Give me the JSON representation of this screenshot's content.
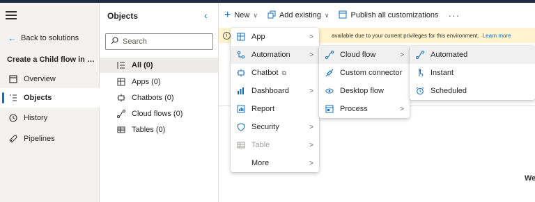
{
  "leftnav": {
    "back_label": "Back to solutions",
    "solution_name": "Create a Child flow in Pa...",
    "items": [
      {
        "label": "Overview",
        "icon": "overview-icon"
      },
      {
        "label": "Objects",
        "icon": "objects-icon",
        "active": true
      },
      {
        "label": "History",
        "icon": "history-icon"
      },
      {
        "label": "Pipelines",
        "icon": "pipelines-icon"
      }
    ]
  },
  "objects": {
    "title": "Objects",
    "search_placeholder": "Search",
    "items": [
      {
        "label": "All  (0)",
        "icon": "all-list-icon",
        "selected": true
      },
      {
        "label": "Apps  (0)",
        "icon": "apps-icon"
      },
      {
        "label": "Chatbots  (0)",
        "icon": "chatbot-icon"
      },
      {
        "label": "Cloud flows  (0)",
        "icon": "cloud-flow-icon"
      },
      {
        "label": "Tables  (0)",
        "icon": "table-icon"
      }
    ]
  },
  "commandbar": {
    "new_label": "New",
    "add_existing_label": "Add existing",
    "publish_label": "Publish all customizations"
  },
  "infobar": {
    "message": "available due to your current privileges for this environment.",
    "link": "Learn more"
  },
  "menu_new": [
    {
      "label": "App",
      "icon": "app-icon",
      "submenu": true
    },
    {
      "label": "Automation",
      "icon": "automation-icon",
      "submenu": true,
      "highlighted": true
    },
    {
      "label": "Chatbot",
      "icon": "chatbot-icon",
      "external": true
    },
    {
      "label": "Dashboard",
      "icon": "dashboard-icon",
      "submenu": true
    },
    {
      "label": "Report",
      "icon": "report-icon"
    },
    {
      "label": "Security",
      "icon": "security-icon",
      "submenu": true
    },
    {
      "label": "Table",
      "icon": "table-icon",
      "submenu": true,
      "disabled": true
    },
    {
      "label": "More",
      "submenu": true
    }
  ],
  "menu_automation": [
    {
      "label": "Cloud flow",
      "icon": "cloud-flow-icon",
      "submenu": true,
      "highlighted": true
    },
    {
      "label": "Custom connector",
      "icon": "custom-connector-icon"
    },
    {
      "label": "Desktop flow",
      "icon": "desktop-flow-icon"
    },
    {
      "label": "Process",
      "icon": "process-icon",
      "submenu": true
    }
  ],
  "menu_cloudflow": [
    {
      "label": "Automated",
      "icon": "automated-flow-icon",
      "highlighted": true
    },
    {
      "label": "Instant",
      "icon": "instant-flow-icon"
    },
    {
      "label": "Scheduled",
      "icon": "scheduled-flow-icon"
    }
  ],
  "main": {
    "partial_text": "We"
  },
  "colors": {
    "accent": "#0f6cbd",
    "info_bg": "#fff4ce",
    "nav_bg": "#f3f2f1"
  }
}
